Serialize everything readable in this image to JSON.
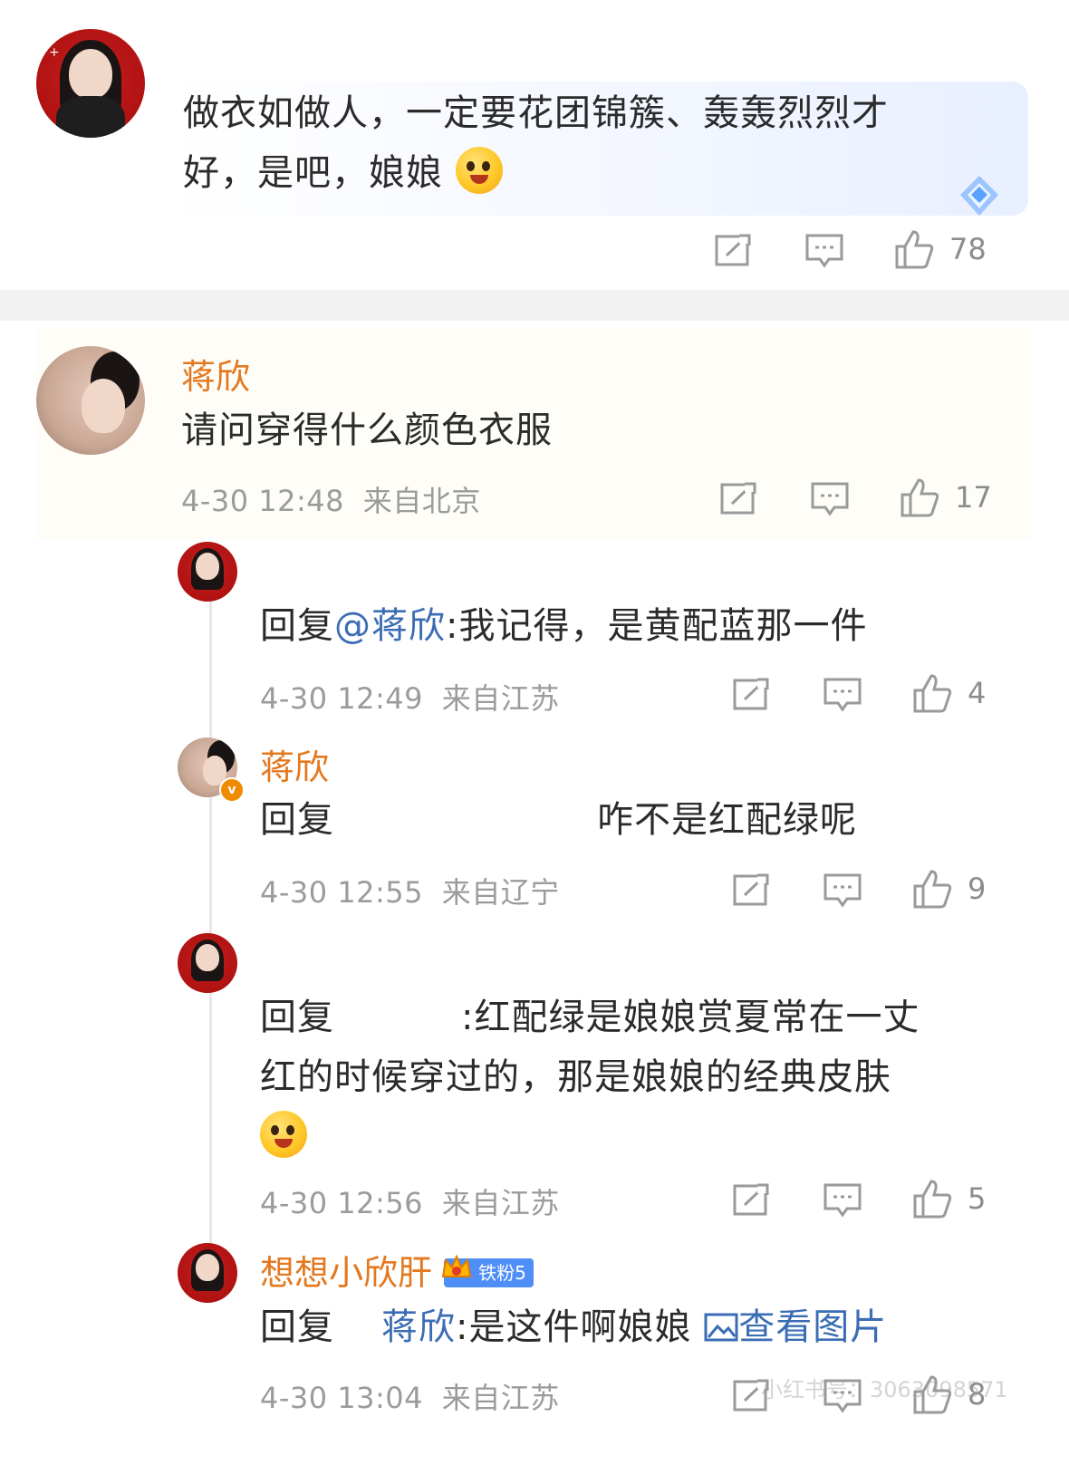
{
  "top_comment": {
    "avatar": "red-portrait-avatar",
    "line1": "做衣如做人，一定要花团锦簇、轰轰烈烈才",
    "line2": "好，是吧，娘娘",
    "emoji": "laughing-emoji",
    "likes": "78",
    "icons": [
      "share-icon",
      "comment-icon",
      "like-icon"
    ]
  },
  "main_comment": {
    "name": "蒋欣",
    "text": "请问穿得什么颜色衣服",
    "time": "4-30 12:48",
    "location": "来自北京",
    "likes": "17"
  },
  "replies": [
    {
      "name": "",
      "prefix": "回复",
      "mention": "@蒋欣",
      "text": ":我记得，是黄配蓝那一件",
      "time": "4-30 12:49",
      "location": "来自江苏",
      "likes": "4"
    },
    {
      "name": "蒋欣",
      "prefix": "回复",
      "text": "咋不是红配绿呢",
      "time": "4-30 12:55",
      "location": "来自辽宁",
      "likes": "9",
      "verified_badge": "v"
    },
    {
      "name": "",
      "prefix": "回复",
      "text_line1": ":红配绿是娘娘赏夏常在一丈",
      "text_line2": "红的时候穿过的，那是娘娘的经典皮肤",
      "time": "4-30 12:56",
      "location": "来自江苏",
      "likes": "5"
    },
    {
      "name": "想想小欣肝",
      "fan_badge": "铁粉5",
      "prefix": "回复",
      "mention": "蒋欣",
      "text": ":是这件啊娘娘",
      "view_image": "查看图片",
      "time": "4-30 13:04",
      "location": "来自江苏",
      "likes": "8"
    }
  ],
  "watermark": "小红书号：3063098571",
  "colors": {
    "name_orange": "#e4781e",
    "link_blue": "#3b6db4",
    "meta_gray": "#9b9b9b",
    "badge_blue": "#4f8ef7"
  }
}
